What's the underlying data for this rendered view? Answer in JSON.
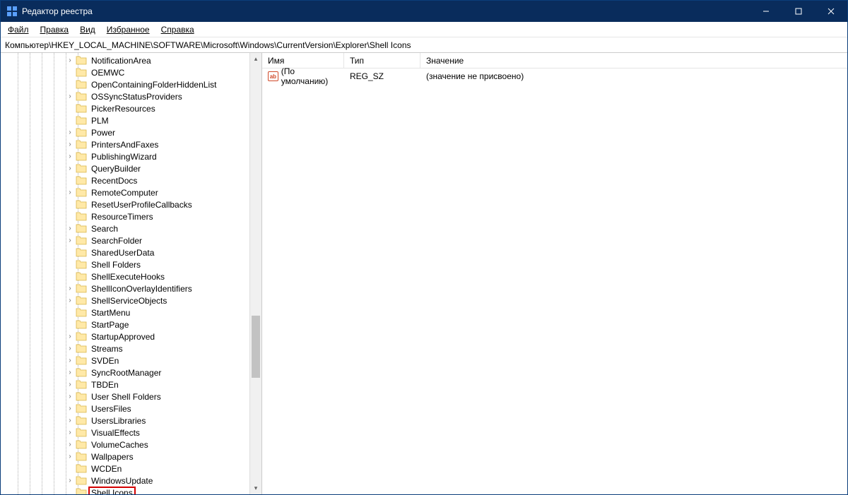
{
  "window": {
    "title": "Редактор реестра"
  },
  "menu": {
    "file": "Файл",
    "edit": "Правка",
    "view": "Вид",
    "favorites": "Избранное",
    "help": "Справка"
  },
  "address": "Компьютер\\HKEY_LOCAL_MACHINE\\SOFTWARE\\Microsoft\\Windows\\CurrentVersion\\Explorer\\Shell Icons",
  "tree": {
    "items": [
      {
        "label": "NotificationArea",
        "expandable": true
      },
      {
        "label": "OEMWC",
        "expandable": false
      },
      {
        "label": "OpenContainingFolderHiddenList",
        "expandable": false
      },
      {
        "label": "OSSyncStatusProviders",
        "expandable": true
      },
      {
        "label": "PickerResources",
        "expandable": false
      },
      {
        "label": "PLM",
        "expandable": false
      },
      {
        "label": "Power",
        "expandable": true
      },
      {
        "label": "PrintersAndFaxes",
        "expandable": true
      },
      {
        "label": "PublishingWizard",
        "expandable": true
      },
      {
        "label": "QueryBuilder",
        "expandable": true
      },
      {
        "label": "RecentDocs",
        "expandable": false
      },
      {
        "label": "RemoteComputer",
        "expandable": true
      },
      {
        "label": "ResetUserProfileCallbacks",
        "expandable": false
      },
      {
        "label": "ResourceTimers",
        "expandable": false
      },
      {
        "label": "Search",
        "expandable": true
      },
      {
        "label": "SearchFolder",
        "expandable": true
      },
      {
        "label": "SharedUserData",
        "expandable": false
      },
      {
        "label": "Shell Folders",
        "expandable": false
      },
      {
        "label": "ShellExecuteHooks",
        "expandable": false
      },
      {
        "label": "ShellIconOverlayIdentifiers",
        "expandable": true
      },
      {
        "label": "ShellServiceObjects",
        "expandable": true
      },
      {
        "label": "StartMenu",
        "expandable": false
      },
      {
        "label": "StartPage",
        "expandable": false
      },
      {
        "label": "StartupApproved",
        "expandable": true
      },
      {
        "label": "Streams",
        "expandable": true
      },
      {
        "label": "SVDEn",
        "expandable": true
      },
      {
        "label": "SyncRootManager",
        "expandable": true
      },
      {
        "label": "TBDEn",
        "expandable": true
      },
      {
        "label": "User Shell Folders",
        "expandable": true
      },
      {
        "label": "UsersFiles",
        "expandable": true
      },
      {
        "label": "UsersLibraries",
        "expandable": true
      },
      {
        "label": "VisualEffects",
        "expandable": true
      },
      {
        "label": "VolumeCaches",
        "expandable": true
      },
      {
        "label": "Wallpapers",
        "expandable": true
      },
      {
        "label": "WCDEn",
        "expandable": false
      },
      {
        "label": "WindowsUpdate",
        "expandable": true
      },
      {
        "label": "Shell Icons",
        "expandable": false,
        "selected": true
      }
    ]
  },
  "columns": {
    "name": "Имя",
    "type": "Тип",
    "data": "Значение"
  },
  "values": [
    {
      "name": "(По умолчанию)",
      "type": "REG_SZ",
      "data": "(значение не присвоено)"
    }
  ]
}
